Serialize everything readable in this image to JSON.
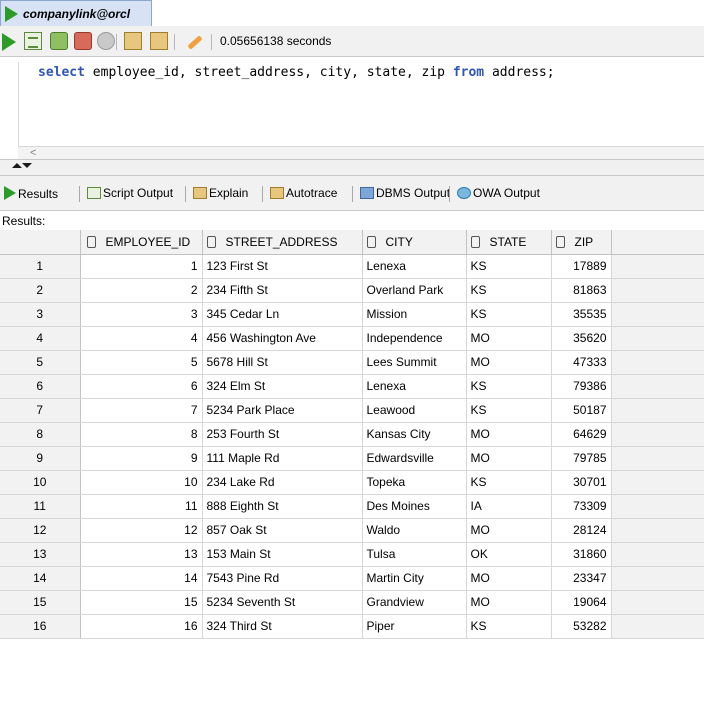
{
  "window": {
    "connection_tab": "companylink@orcl",
    "timing": "0.05656138 seconds"
  },
  "editor": {
    "sql_parts": [
      "select",
      " employee_id, street_address, city, state, zip ",
      "from",
      " address;"
    ]
  },
  "output_tabs": [
    "Results",
    "Script Output",
    "Explain",
    "Autotrace",
    "DBMS Output",
    "OWA Output"
  ],
  "results_label": "Results:",
  "columns": [
    "EMPLOYEE_ID",
    "STREET_ADDRESS",
    "CITY",
    "STATE",
    "ZIP"
  ],
  "rows": [
    {
      "n": "1",
      "employee_id": "1",
      "street_address": "123 First St",
      "city": "Lenexa",
      "state": "KS",
      "zip": "17889"
    },
    {
      "n": "2",
      "employee_id": "2",
      "street_address": "234 Fifth St",
      "city": "Overland Park",
      "state": "KS",
      "zip": "81863"
    },
    {
      "n": "3",
      "employee_id": "3",
      "street_address": "345 Cedar Ln",
      "city": "Mission",
      "state": "KS",
      "zip": "35535"
    },
    {
      "n": "4",
      "employee_id": "4",
      "street_address": "456 Washington Ave",
      "city": "Independence",
      "state": "MO",
      "zip": "35620"
    },
    {
      "n": "5",
      "employee_id": "5",
      "street_address": "5678 Hill St",
      "city": "Lees Summit",
      "state": "MO",
      "zip": "47333"
    },
    {
      "n": "6",
      "employee_id": "6",
      "street_address": "324 Elm St",
      "city": "Lenexa",
      "state": "KS",
      "zip": "79386"
    },
    {
      "n": "7",
      "employee_id": "7",
      "street_address": "5234 Park Place",
      "city": "Leawood",
      "state": "KS",
      "zip": "50187"
    },
    {
      "n": "8",
      "employee_id": "8",
      "street_address": "253 Fourth St",
      "city": "Kansas City",
      "state": "MO",
      "zip": "64629"
    },
    {
      "n": "9",
      "employee_id": "9",
      "street_address": "111 Maple Rd",
      "city": "Edwardsville",
      "state": "MO",
      "zip": "79785"
    },
    {
      "n": "10",
      "employee_id": "10",
      "street_address": "234 Lake Rd",
      "city": "Topeka",
      "state": "KS",
      "zip": "30701"
    },
    {
      "n": "11",
      "employee_id": "11",
      "street_address": "888 Eighth St",
      "city": "Des Moines",
      "state": "IA",
      "zip": "73309"
    },
    {
      "n": "12",
      "employee_id": "12",
      "street_address": "857 Oak St",
      "city": "Waldo",
      "state": "MO",
      "zip": "28124"
    },
    {
      "n": "13",
      "employee_id": "13",
      "street_address": "153 Main St",
      "city": "Tulsa",
      "state": "OK",
      "zip": "31860"
    },
    {
      "n": "14",
      "employee_id": "14",
      "street_address": "7543 Pine Rd",
      "city": "Martin City",
      "state": "MO",
      "zip": "23347"
    },
    {
      "n": "15",
      "employee_id": "15",
      "street_address": "5234 Seventh St",
      "city": "Grandview",
      "state": "MO",
      "zip": "19064"
    },
    {
      "n": "16",
      "employee_id": "16",
      "street_address": "324 Third St",
      "city": "Piper",
      "state": "KS",
      "zip": "53282"
    }
  ]
}
